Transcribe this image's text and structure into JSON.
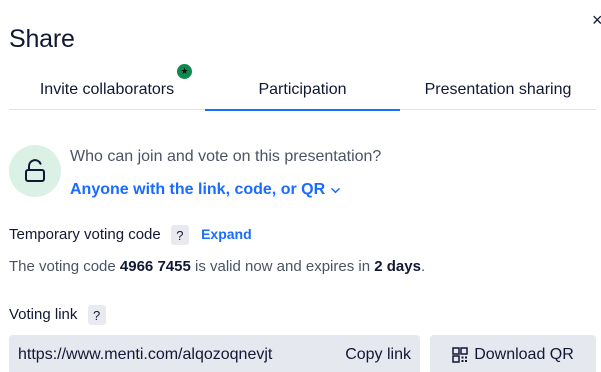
{
  "dialog": {
    "title": "Share",
    "close_glyph": "×"
  },
  "tabs": [
    {
      "label": "Invite collaborators",
      "badge": "★"
    },
    {
      "label": "Participation",
      "active": true
    },
    {
      "label": "Presentation sharing"
    }
  ],
  "access": {
    "question": "Who can join and vote on this presentation?",
    "selected_option": "Anyone with the link, code, or QR",
    "icon": "lock-open-icon"
  },
  "voting_code": {
    "label": "Temporary voting code",
    "help": "?",
    "expand_label": "Expand",
    "text_prefix": "The voting code ",
    "code": "4966 7455",
    "text_middle": " is valid now and expires in ",
    "expiry": "2 days",
    "text_suffix": "."
  },
  "voting_link": {
    "label": "Voting link",
    "help": "?",
    "url": "https://www.menti.com/alqozoqnevjt",
    "copy_label": "Copy link",
    "download_qr_label": "Download QR"
  },
  "colors": {
    "accent": "#196cff",
    "badge_green": "#0f8a4f",
    "lock_bg": "#dbf1e6"
  }
}
